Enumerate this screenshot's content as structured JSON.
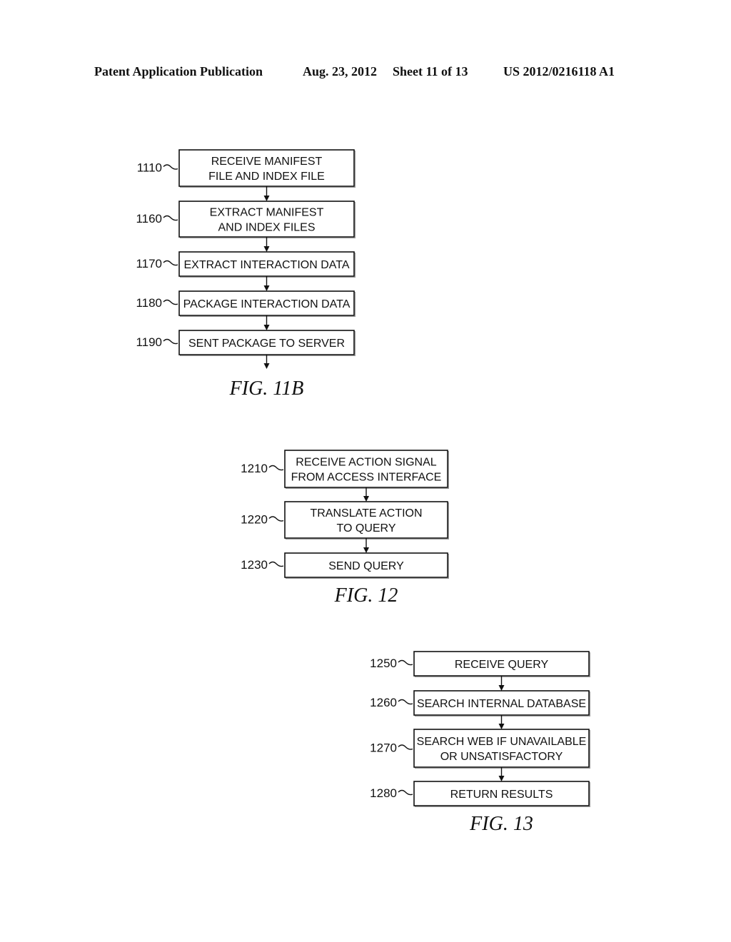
{
  "header": {
    "publication": "Patent Application Publication",
    "date": "Aug. 23, 2012",
    "sheet": "Sheet 11 of 13",
    "number": "US 2012/0216118 A1"
  },
  "figures": [
    {
      "id": "fig11b",
      "caption": "FIG. 11B",
      "steps": [
        {
          "ref": "1110",
          "lines": [
            "RECEIVE MANIFEST",
            "FILE AND INDEX FILE"
          ]
        },
        {
          "ref": "1160",
          "lines": [
            "EXTRACT MANIFEST",
            "AND INDEX FILES"
          ]
        },
        {
          "ref": "1170",
          "lines": [
            "EXTRACT INTERACTION DATA"
          ]
        },
        {
          "ref": "1180",
          "lines": [
            "PACKAGE INTERACTION DATA"
          ]
        },
        {
          "ref": "1190",
          "lines": [
            "SENT PACKAGE TO SERVER"
          ]
        }
      ],
      "trailing_arrow": true
    },
    {
      "id": "fig12",
      "caption": "FIG. 12",
      "steps": [
        {
          "ref": "1210",
          "lines": [
            "RECEIVE ACTION SIGNAL",
            "FROM ACCESS INTERFACE"
          ]
        },
        {
          "ref": "1220",
          "lines": [
            "TRANSLATE ACTION",
            "TO QUERY"
          ]
        },
        {
          "ref": "1230",
          "lines": [
            "SEND QUERY"
          ]
        }
      ],
      "trailing_arrow": false
    },
    {
      "id": "fig13",
      "caption": "FIG. 13",
      "steps": [
        {
          "ref": "1250",
          "lines": [
            "RECEIVE QUERY"
          ]
        },
        {
          "ref": "1260",
          "lines": [
            "SEARCH INTERNAL DATABASE"
          ]
        },
        {
          "ref": "1270",
          "lines": [
            "SEARCH WEB IF UNAVAILABLE",
            "OR UNSATISFACTORY"
          ]
        },
        {
          "ref": "1280",
          "lines": [
            "RETURN RESULTS"
          ]
        }
      ],
      "trailing_arrow": false
    }
  ]
}
